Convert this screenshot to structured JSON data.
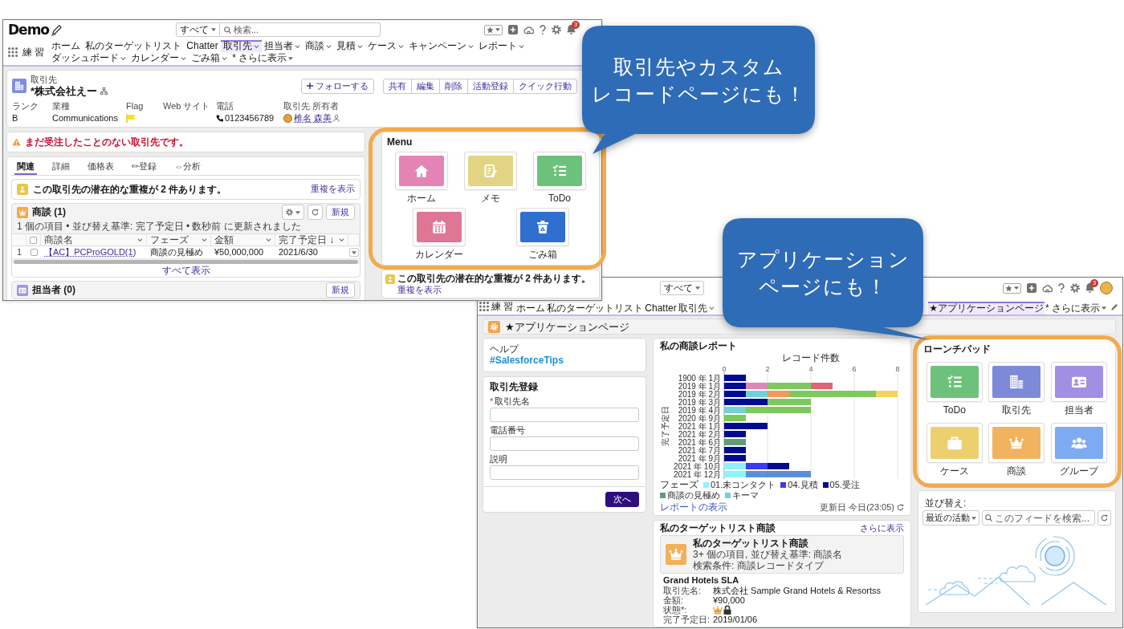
{
  "callouts": [
    {
      "lines": [
        "取引先やカスタム",
        "レコードページにも！"
      ]
    },
    {
      "lines": [
        "アプリケーション",
        "ページにも！"
      ]
    }
  ],
  "record_page": {
    "header": {
      "logo": "Demo",
      "search_scope": "すべて",
      "search_placeholder": "検索...",
      "notification_count": "3"
    },
    "app_name": "練 習",
    "nav_items": [
      {
        "label": "ホーム",
        "kind": "link",
        "selected": false
      },
      {
        "label": "私のターゲットリスト",
        "kind": "link",
        "selected": false
      },
      {
        "label": "Chatter",
        "kind": "link",
        "selected": false
      },
      {
        "label": "取引先",
        "kind": "menu",
        "selected": true
      },
      {
        "label": "担当者",
        "kind": "menu",
        "selected": false
      },
      {
        "label": "商談",
        "kind": "menu",
        "selected": false
      },
      {
        "label": "見積",
        "kind": "menu",
        "selected": false
      },
      {
        "label": "ケース",
        "kind": "menu",
        "selected": false
      },
      {
        "label": "キャンペーン",
        "kind": "menu",
        "selected": false
      },
      {
        "label": "レポート",
        "kind": "menu",
        "selected": false
      },
      {
        "label": "ダッシュボード",
        "kind": "menu",
        "selected": false
      },
      {
        "label": "カレンダー",
        "kind": "menu",
        "selected": false
      },
      {
        "label": "ごみ箱",
        "kind": "menu",
        "selected": false
      },
      {
        "label": "* さらに表示",
        "kind": "more",
        "selected": false
      }
    ],
    "record": {
      "object_label": "取引先",
      "name": "*株式会社えー",
      "follow_button": "フォローする",
      "actions": [
        "共有",
        "編集",
        "削除",
        "活動登録",
        "クイック行動"
      ],
      "fields": [
        {
          "label": "ランク",
          "kind": "text",
          "value": "B"
        },
        {
          "label": "業種",
          "kind": "text",
          "value": "Communications"
        },
        {
          "label": "Flag",
          "kind": "flag"
        },
        {
          "label": "Web サイト",
          "kind": "text"
        },
        {
          "label": "電話",
          "kind": "phone",
          "value": "0123456789"
        },
        {
          "label": "取引先 所有者",
          "kind": "owner",
          "value": "椎名 森美"
        }
      ]
    },
    "alert": "まだ受注したことのない取引先です。",
    "tabs": [
      {
        "label": "関連",
        "selected": true
      },
      {
        "label": "詳細",
        "selected": false
      },
      {
        "label": "価格表",
        "selected": false
      },
      {
        "label": "✏登録",
        "selected": false
      },
      {
        "label": "⇔分析",
        "selected": false
      }
    ],
    "duplicate_notice": {
      "text": "この取引先の潜在的な重複が 2 件あります。",
      "link": "重複を表示"
    },
    "related_lists": [
      {
        "kind": "opportunity",
        "title": "商談 (1)",
        "tools": true,
        "new_button": "新規",
        "status": "1 個の項目 • 並び替え基準: 完了予定日 • 数秒前 に更新されました",
        "table": {
          "all_checked": false,
          "columns": [
            {
              "label": "商談名",
              "kind": "link"
            },
            {
              "label": "フェーズ",
              "kind": "text"
            },
            {
              "label": "金額",
              "kind": "text"
            },
            {
              "label": "完了予定日 ↓",
              "kind": "text"
            }
          ],
          "rows": [
            {
              "number": "1",
              "checked": false,
              "cells": [
                "【AC】PCProGOLD(1)",
                "商談の見極め",
                "¥50,000,000",
                "2021/6/30"
              ]
            }
          ]
        },
        "view_all": "すべて表示"
      },
      {
        "kind": "contact",
        "title": "担当者 (0)",
        "tools": false,
        "new_button": "新規"
      }
    ],
    "menu": {
      "title": "Menu",
      "rows": [
        {
          "tiles": [
            {
              "label": "ホーム",
              "kind": "home",
              "color": "#e384b5"
            },
            {
              "label": "メモ",
              "kind": "memo",
              "color": "#e3d483"
            },
            {
              "label": "ToDo",
              "kind": "todo",
              "color": "#6cc27a"
            }
          ]
        },
        {
          "tiles": [
            {
              "label": "カレンダー",
              "kind": "calendar",
              "color": "#dd7793"
            },
            {
              "label": "ごみ箱",
              "kind": "trash",
              "color": "#2f6fd0"
            }
          ]
        }
      ]
    },
    "side_notice": {
      "text": "この取引先の潜在的な重複が 2 件あります。",
      "link": "重複を表示"
    }
  },
  "app_page": {
    "header": {
      "search_scope": "すべて",
      "notification_count": "3"
    },
    "app_name": "練 習",
    "nav_items": [
      {
        "label": "ホーム",
        "kind": "link",
        "selected": false
      },
      {
        "label": "私のターゲットリスト",
        "kind": "link",
        "selected": false
      },
      {
        "label": "Chatter",
        "kind": "link",
        "selected": false
      },
      {
        "label": "取引先",
        "kind": "menu",
        "selected": false
      }
    ],
    "nav_end_items": [
      {
        "label": "★アプリケーションページ",
        "kind": "link",
        "selected": true
      },
      {
        "label": "* さらに表示",
        "kind": "more",
        "selected": false
      }
    ],
    "page_title": "★アプリケーションページ",
    "help": {
      "title": "ヘルプ",
      "link": "#SalesforceTips"
    },
    "form": {
      "title": "取引先登録",
      "fields": [
        {
          "label": "取引先名",
          "marker": "*"
        },
        {
          "label": "電話番号"
        },
        {
          "label": "説明"
        }
      ],
      "submit": "次へ"
    },
    "report": {
      "title": "私の商談レポート",
      "chart_data": {
        "type": "bar",
        "orientation": "horizontal",
        "stacked": true,
        "grid": true,
        "xlabel": "レコード件数",
        "ylabel": "完了予定日",
        "categories": [
          "1900 年 1月",
          "2019 年 1月",
          "2019 年 2月",
          "2019 年 3月",
          "2019 年 4月",
          "2020 年 9月",
          "2021 年 1月",
          "2021 年 2月",
          "2021 年 6月",
          "2021 年 7月",
          "2021 年 9月",
          "2021 年 10月",
          "2021 年 12月"
        ],
        "xlim": [
          0,
          8
        ],
        "xticks": [
          0,
          2,
          4,
          6,
          8
        ],
        "series": [
          {
            "name": "01.未コンタクト",
            "color": "#8ef2fa",
            "values": [
              null,
              null,
              null,
              null,
              null,
              null,
              null,
              null,
              null,
              null,
              null,
              1,
              1
            ]
          },
          {
            "name": "04.見積",
            "color": "#3b3bf0",
            "values": [
              null,
              null,
              null,
              null,
              null,
              null,
              null,
              null,
              null,
              null,
              null,
              1,
              null
            ]
          },
          {
            "name": "05.受注",
            "color": "#000b8f",
            "values": [
              1,
              1,
              1,
              2,
              null,
              null,
              2,
              1,
              null,
              1,
              1,
              1,
              null
            ]
          },
          {
            "name": "商談の見極め",
            "color": "#5f9f78",
            "values": [
              null,
              null,
              null,
              null,
              null,
              null,
              null,
              null,
              1,
              null,
              null,
              null,
              null
            ]
          },
          {
            "name": "キーマ",
            "color": "#74cfd6",
            "values": [
              null,
              null,
              1,
              null,
              1,
              null,
              null,
              null,
              null,
              null,
              null,
              null,
              null
            ]
          },
          {
            "color": "#d98ab3",
            "values": [
              null,
              1,
              null,
              null,
              null,
              null,
              null,
              null,
              null,
              null,
              null,
              null,
              null
            ]
          },
          {
            "color": "#ec9c5a",
            "values": [
              null,
              null,
              1,
              null,
              null,
              null,
              null,
              null,
              null,
              null,
              null,
              null,
              null
            ]
          },
          {
            "color": "#7ec95f",
            "values": [
              null,
              2,
              4,
              2,
              3,
              1,
              null,
              null,
              null,
              null,
              null,
              null,
              null
            ]
          },
          {
            "color": "#de6571",
            "values": [
              null,
              1,
              null,
              null,
              null,
              null,
              null,
              null,
              null,
              null,
              null,
              null,
              null
            ]
          },
          {
            "color": "#f1d65b",
            "values": [
              null,
              null,
              1,
              null,
              null,
              null,
              null,
              null,
              null,
              null,
              null,
              null,
              null
            ]
          },
          {
            "color": "#5d8fd9",
            "values": [
              null,
              null,
              null,
              null,
              null,
              null,
              null,
              null,
              null,
              null,
              null,
              null,
              3
            ]
          }
        ]
      },
      "legend_title": "フェーズ",
      "view_link": "レポートの表示",
      "updated": "更新日 今日(23:05)"
    },
    "target_list": {
      "title": "私のターゲットリスト商談",
      "more_link": "さらに表示",
      "list_title": "私のターゲットリスト商談",
      "summary": "3+ 個の項目, 並び替え基準: 商談名",
      "filter": "検索条件: 商談レコードタイプ",
      "record": {
        "name": "Grand Hotels SLA",
        "fields": [
          {
            "label": "取引先名:",
            "kind": "text",
            "value": "株式会社 Sample Grand Hotels & Resortss"
          },
          {
            "label": "金額:",
            "kind": "text",
            "value": "¥90,000"
          },
          {
            "label": "状態*:",
            "kind": "icons"
          },
          {
            "label": "完了予定日:",
            "kind": "text",
            "value": "2019/01/06"
          }
        ]
      }
    },
    "launchpad": {
      "title": "ローンチパッド",
      "rows": [
        {
          "tiles": [
            {
              "label": "ToDo",
              "kind": "todo",
              "color": "#6cc27a"
            },
            {
              "label": "取引先",
              "kind": "account",
              "color": "#7d8ad9"
            },
            {
              "label": "担当者",
              "kind": "contact",
              "color": "#a18fe3"
            }
          ]
        },
        {
          "tiles": [
            {
              "label": "ケース",
              "kind": "case",
              "color": "#ecd06e"
            },
            {
              "label": "商談",
              "kind": "opportunity",
              "color": "#f2b35e"
            },
            {
              "label": "グループ",
              "kind": "group",
              "color": "#7eaaf2"
            }
          ]
        }
      ]
    },
    "feed": {
      "sort_label": "並び替え:",
      "sort_value": "最近の活動",
      "search_placeholder": "このフィードを検索..."
    }
  }
}
